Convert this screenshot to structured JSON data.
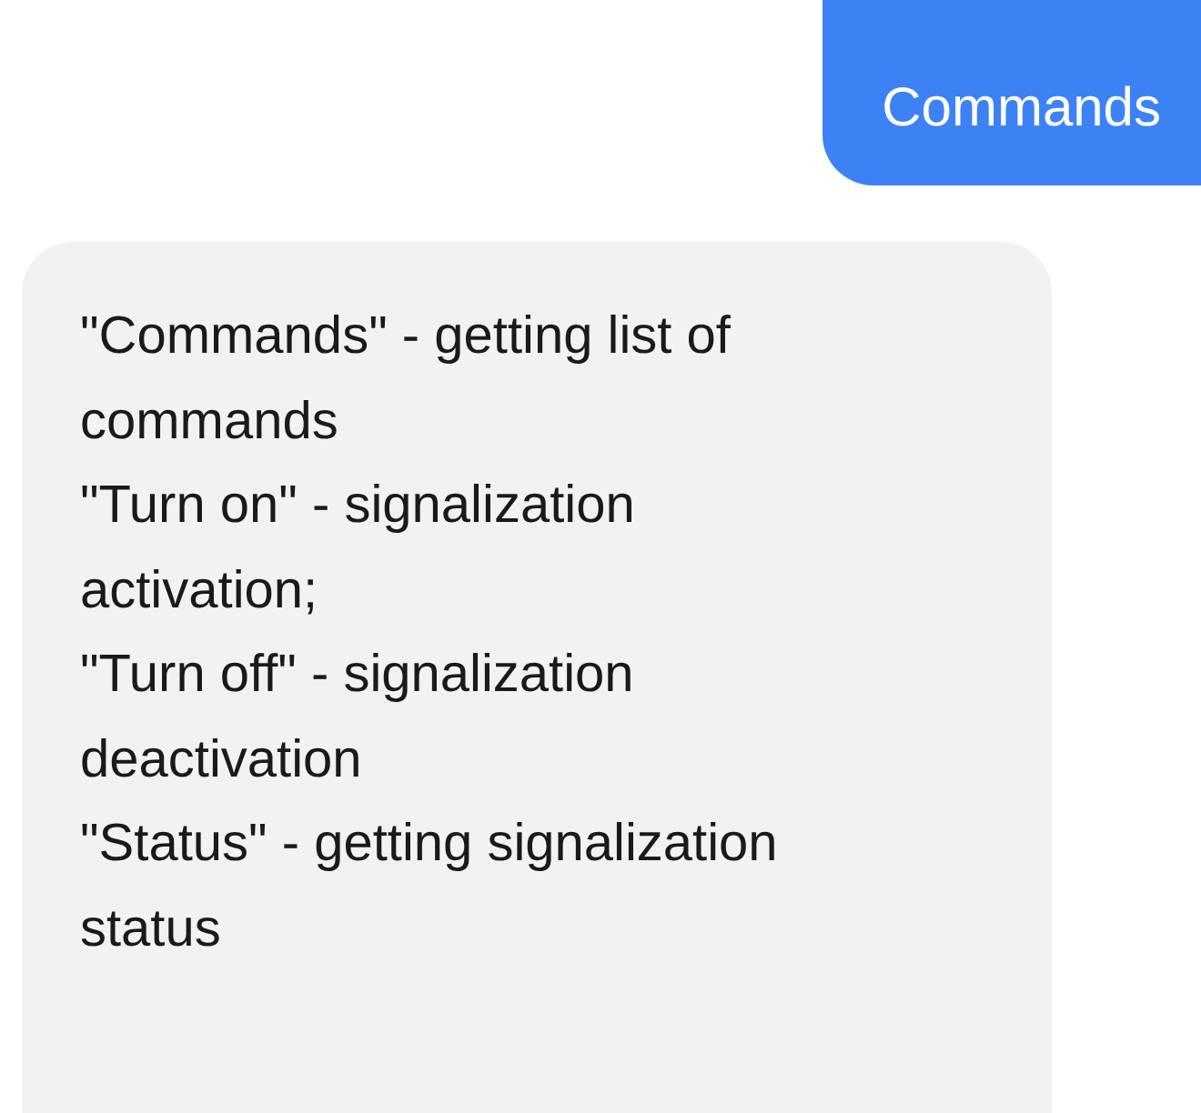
{
  "messages": [
    {
      "kind": "outgoing",
      "lines": [
        "Commands"
      ]
    },
    {
      "kind": "incoming",
      "lines": [
        "\"Commands\" - getting list of",
        "commands",
        "\"Turn on\" - signalization",
        "activation;",
        "\"Turn off\" - signalization",
        "deactivation",
        "\"Status\" - getting signalization",
        "status"
      ]
    }
  ]
}
